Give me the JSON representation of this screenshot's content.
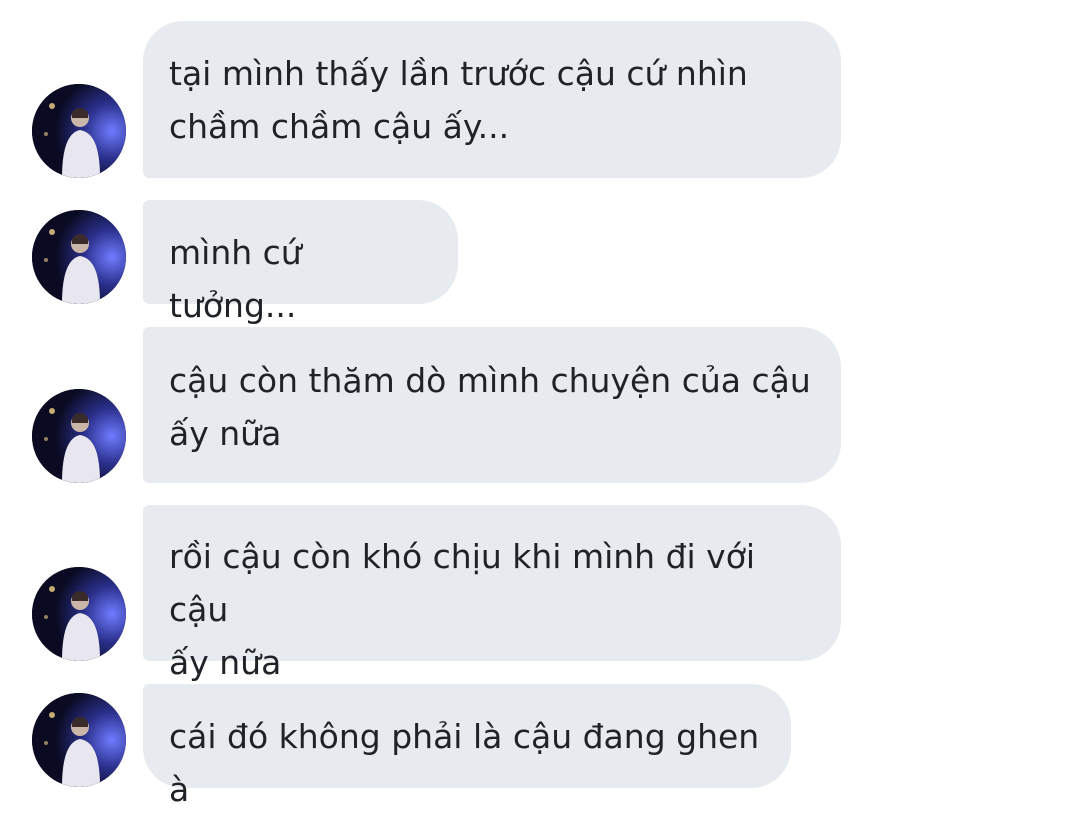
{
  "chat": {
    "contact_avatar": "avatar-photo",
    "bubble_color": "#e7ebf0",
    "text_color": "#1f2226",
    "messages": [
      {
        "text": "tại mình thấy lần trước cậu cứ nhìn\nchầm chầm cậu ấy..."
      },
      {
        "text": "mình cứ tưởng..."
      },
      {
        "text": "cậu còn thăm dò mình chuyện của cậu\nấy nữa"
      },
      {
        "text": "rồi cậu còn khó chịu khi mình đi với cậu\nấy nữa"
      },
      {
        "text": "cái đó không phải là cậu đang ghen à"
      }
    ]
  }
}
